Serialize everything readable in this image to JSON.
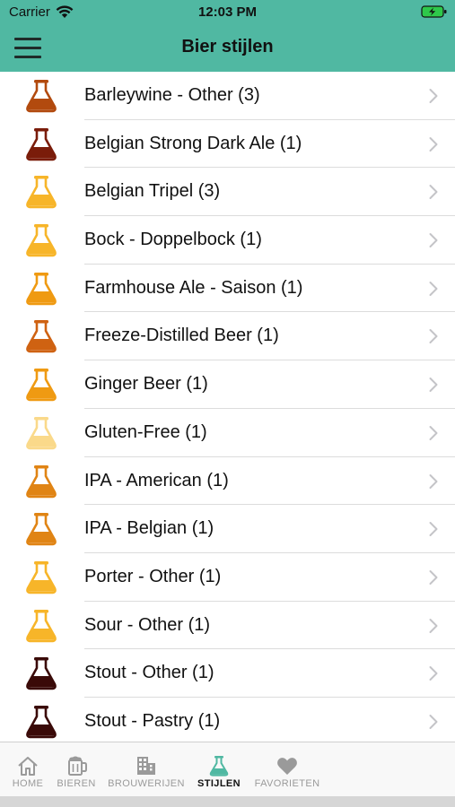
{
  "status": {
    "carrier": "Carrier",
    "time": "12:03 PM"
  },
  "nav": {
    "title": "Bier stijlen",
    "menu_icon": "hamburger-menu-icon"
  },
  "styles": [
    {
      "label": "Barleywine - Other (3)",
      "color": "#b24a0e"
    },
    {
      "label": "Belgian Strong Dark Ale (1)",
      "color": "#7a1c0a"
    },
    {
      "label": "Belgian Tripel (3)",
      "color": "#f7b529"
    },
    {
      "label": "Bock - Doppelbock (1)",
      "color": "#f7b529"
    },
    {
      "label": "Farmhouse Ale - Saison (1)",
      "color": "#ef9a12"
    },
    {
      "label": "Freeze-Distilled Beer (1)",
      "color": "#cf6212"
    },
    {
      "label": "Ginger Beer (1)",
      "color": "#ef9a12"
    },
    {
      "label": "Gluten-Free (1)",
      "color": "#fad98a"
    },
    {
      "label": "IPA - American (1)",
      "color": "#e08414"
    },
    {
      "label": "IPA - Belgian (1)",
      "color": "#e08414"
    },
    {
      "label": "Porter - Other (1)",
      "color": "#f7b529"
    },
    {
      "label": "Sour - Other (1)",
      "color": "#f7b529"
    },
    {
      "label": "Stout - Other (1)",
      "color": "#3a0a08"
    },
    {
      "label": "Stout - Pastry (1)",
      "color": "#3a0a08"
    }
  ],
  "tabs": [
    {
      "label": "HOME",
      "icon": "home-icon",
      "active": false
    },
    {
      "label": "BIEREN",
      "icon": "beer-mug-icon",
      "active": false
    },
    {
      "label": "BROUWERIJEN",
      "icon": "building-icon",
      "active": false
    },
    {
      "label": "STIJLEN",
      "icon": "flask-icon",
      "active": true
    },
    {
      "label": "FAVORIETEN",
      "icon": "heart-icon",
      "active": false
    }
  ],
  "colors": {
    "accent": "#50b8a2",
    "active_tab_icon": "#50b8a2",
    "inactive": "#9a9a9a"
  }
}
